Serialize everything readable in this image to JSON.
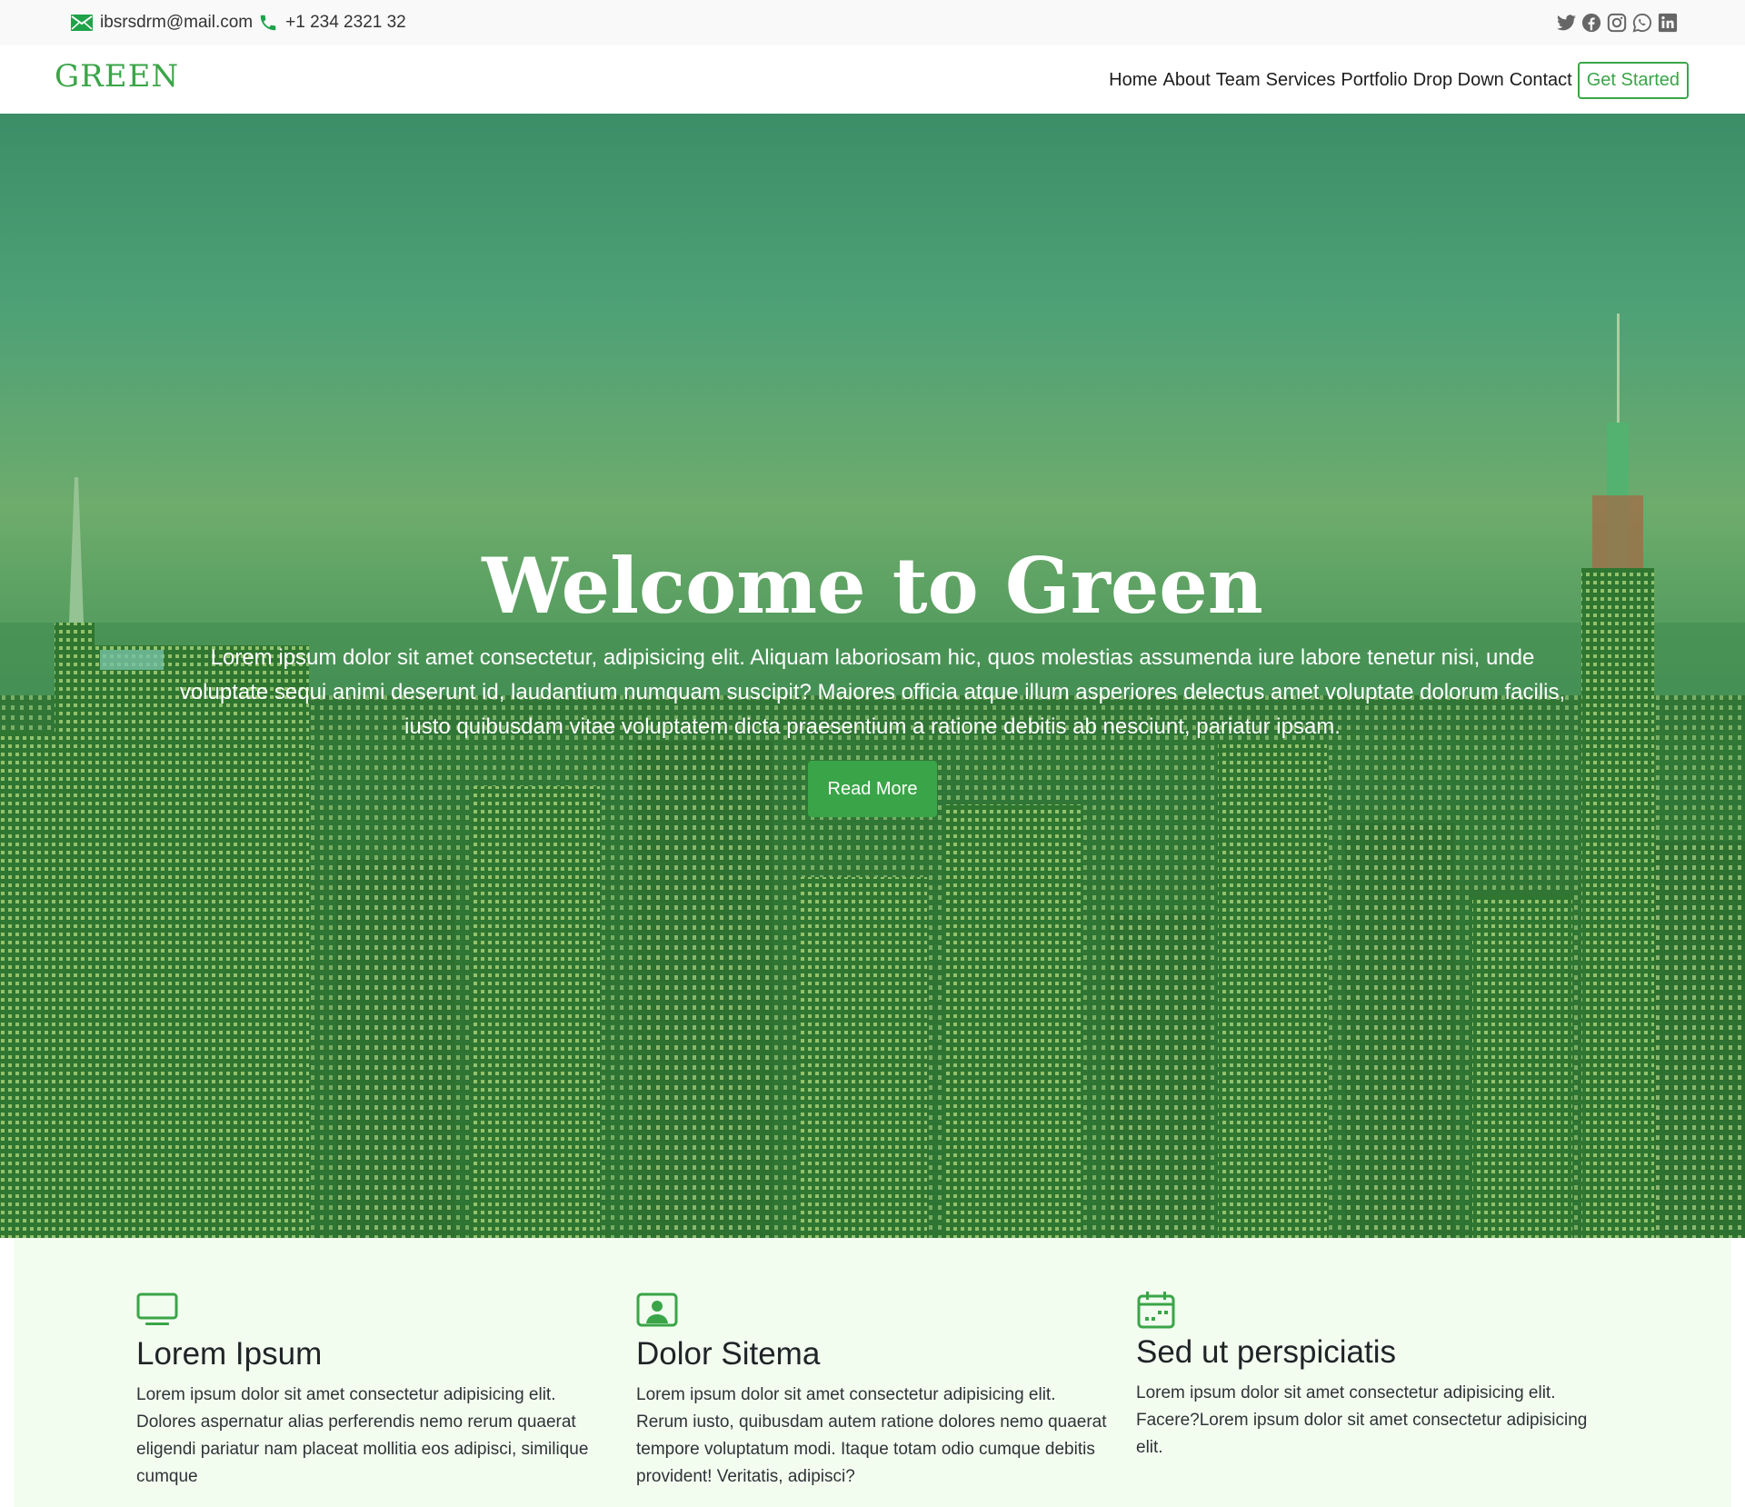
{
  "topbar": {
    "email": "ibsrsdrm@mail.com",
    "phone": "+1 234 2321 32",
    "email_icon": "envelope-icon",
    "phone_icon": "phone-icon",
    "social": [
      "twitter-icon",
      "facebook-icon",
      "instagram-icon",
      "whatsapp-icon",
      "linkedin-icon"
    ]
  },
  "nav": {
    "logo": "GREEN",
    "items": [
      "Home",
      "About",
      "Team",
      "Services",
      "Portfolio",
      "Drop Down",
      "Contact"
    ],
    "cta": "Get Started"
  },
  "hero": {
    "title": "Welcome to Green",
    "text": "Lorem ipsum dolor sit amet consectetur, adipisicing elit. Aliquam laboriosam hic, quos molestias assumenda iure labore tenetur nisi, unde voluptate sequi animi deserunt id, laudantium numquam suscipit? Maiores officia atque illum asperiores delectus amet voluptate dolorum facilis, iusto quibusdam vitae voluptatem dicta praesentium a ratione debitis ab nesciunt, pariatur ipsam.",
    "button": "Read More"
  },
  "features": [
    {
      "icon": "monitor-icon",
      "title": "Lorem Ipsum",
      "text": "Lorem ipsum dolor sit amet consectetur adipisicing elit. Dolores aspernatur alias perferendis nemo rerum quaerat eligendi pariatur nam placeat mollitia eos adipisci, similique cumque"
    },
    {
      "icon": "person-badge-icon",
      "title": "Dolor Sitema",
      "text": "Lorem ipsum dolor sit amet consectetur adipisicing elit. Rerum iusto, quibusdam autem ratione dolores nemo quaerat tempore voluptatum modi. Itaque totam odio cumque debitis provident! Veritatis, adipisci?"
    },
    {
      "icon": "calendar-icon",
      "title": "Sed ut perspiciatis",
      "text": "Lorem ipsum dolor sit amet consectetur adipisicing elit. Facere?Lorem ipsum dolor sit amet consectetur adipisicing elit."
    }
  ],
  "colors": {
    "accent": "#3aa548",
    "feature_bg": "#f2fdf0",
    "topbar_bg": "#f8f9f8"
  }
}
